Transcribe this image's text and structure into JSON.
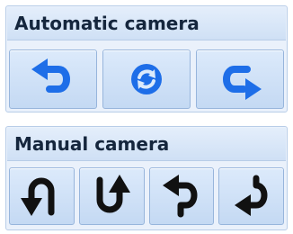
{
  "automatic_camera": {
    "title": "Automatic camera",
    "buttons": [
      {
        "icon": "rotate-left-arrow-icon"
      },
      {
        "icon": "refresh-icon"
      },
      {
        "icon": "rotate-right-arrow-icon"
      }
    ],
    "icon_color": "#1e6ee8"
  },
  "manual_camera": {
    "title": "Manual camera",
    "buttons": [
      {
        "icon": "arc-left-arrow-icon"
      },
      {
        "icon": "u-turn-up-arrow-icon"
      },
      {
        "icon": "hook-left-arrow-icon"
      },
      {
        "icon": "hook-right-arrow-icon"
      }
    ],
    "icon_color": "#111111"
  }
}
